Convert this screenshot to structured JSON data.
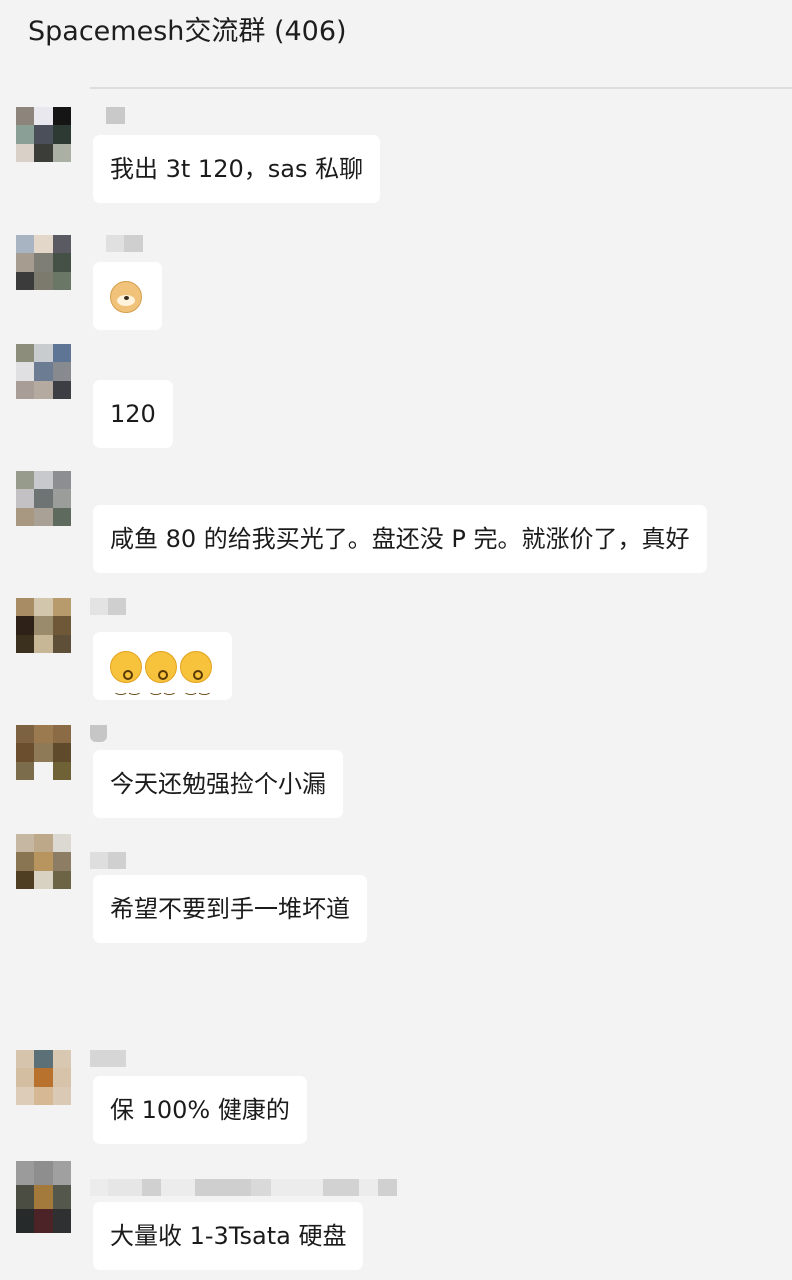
{
  "chat": {
    "title": "Spacemesh交流群 (406)"
  },
  "messages": [
    {
      "text": "我出 3t 120，sas 私聊"
    },
    {
      "text": "",
      "emoji": "dog-face-icon"
    },
    {
      "text": "120"
    },
    {
      "text": "咸鱼 80 的给我买光了。盘还没 P 完。就涨价了，真好"
    },
    {
      "text": "",
      "emoji": "kissing-face-icon"
    },
    {
      "text": "今天还勉强捡个小漏"
    },
    {
      "text": "希望不要到手一堆坏道"
    },
    {
      "text": "保 100% 健康的"
    },
    {
      "text": "大量收 1-3Tsata 硬盘"
    }
  ],
  "colors": {
    "background": "#f3f3f3",
    "bubble": "#ffffff",
    "text": "#1b1b1b"
  }
}
